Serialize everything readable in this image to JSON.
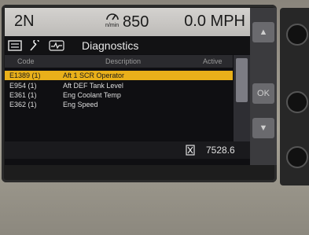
{
  "status": {
    "gear": "2N",
    "rpm_unit": "n/min",
    "rpm_value": "850",
    "speed": "0.0 MPH"
  },
  "titlebar": {
    "title": "Diagnostics",
    "icons": [
      "menu-card-icon",
      "wrench-icon",
      "ekg-wave-icon"
    ]
  },
  "table": {
    "headers": {
      "code": "Code",
      "description": "Description",
      "active": "Active"
    },
    "rows": [
      {
        "code": "E1389 (1)",
        "description": "Aft 1 SCR Operator",
        "active": "",
        "selected": true
      },
      {
        "code": "E954 (1)",
        "description": "Aft DEF Tank Level",
        "active": "",
        "selected": false
      },
      {
        "code": "E361 (1)",
        "description": "Eng Coolant Temp",
        "active": "",
        "selected": false
      },
      {
        "code": "E362 (1)",
        "description": "Eng Speed",
        "active": "",
        "selected": false
      }
    ]
  },
  "footer": {
    "icon": "hourglass-icon",
    "hours": "7528.6"
  },
  "side": {
    "ok_label": "OK"
  },
  "colors": {
    "selected_row": "#e9b01a",
    "status_bar": "#c9c7c4",
    "screen_bg": "#0f0f12"
  }
}
